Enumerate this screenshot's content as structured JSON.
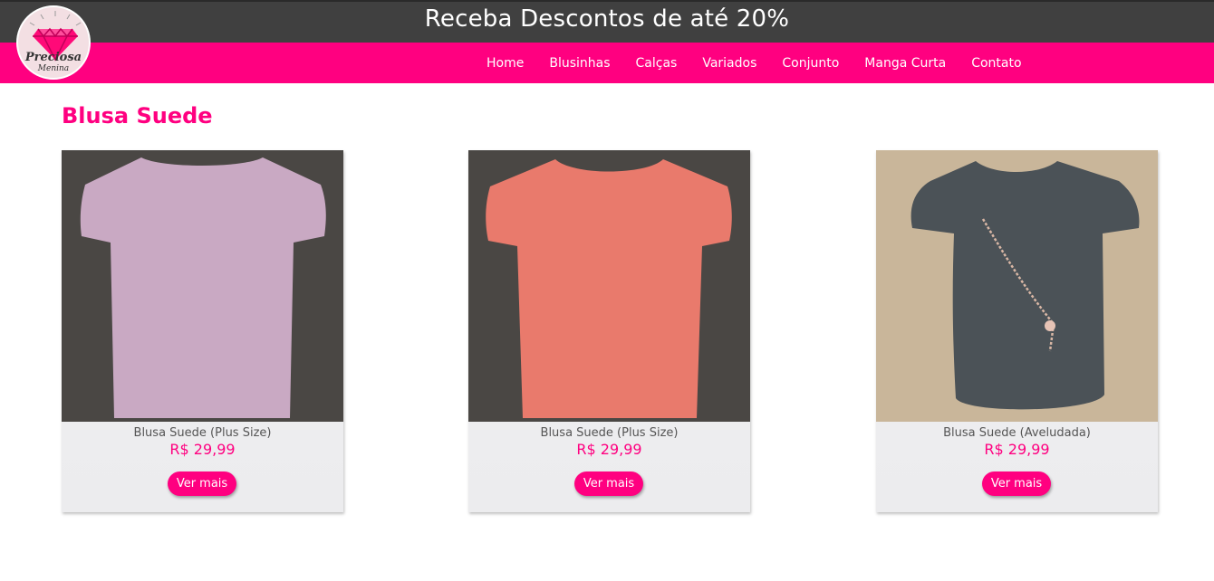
{
  "header": {
    "promo_text": "Receba Descontos de até 20%",
    "logo_text": "Preciosa",
    "logo_subtext": "Menina"
  },
  "nav": {
    "items": [
      {
        "label": "Home"
      },
      {
        "label": "Blusinhas"
      },
      {
        "label": "Calças"
      },
      {
        "label": "Variados"
      },
      {
        "label": "Conjunto"
      },
      {
        "label": "Manga Curta"
      },
      {
        "label": "Contato"
      }
    ]
  },
  "colors": {
    "accent": "#ff0080",
    "topbar": "#404040"
  },
  "section": {
    "title": "Blusa Suede"
  },
  "products": [
    {
      "name": "Blusa Suede (Plus Size)",
      "price": "R$ 29,99",
      "button": "Ver mais",
      "shirt_color": "#c9a9c3",
      "bg_color": "#4a4744"
    },
    {
      "name": "Blusa Suede (Plus Size)",
      "price": "R$ 29,99",
      "button": "Ver mais",
      "shirt_color": "#e97a6c",
      "bg_color": "#4a4744"
    },
    {
      "name": "Blusa Suede (Aveludada)",
      "price": "R$ 29,99",
      "button": "Ver mais",
      "shirt_color": "#4b5257",
      "bg_color": "#c9b69a"
    }
  ]
}
